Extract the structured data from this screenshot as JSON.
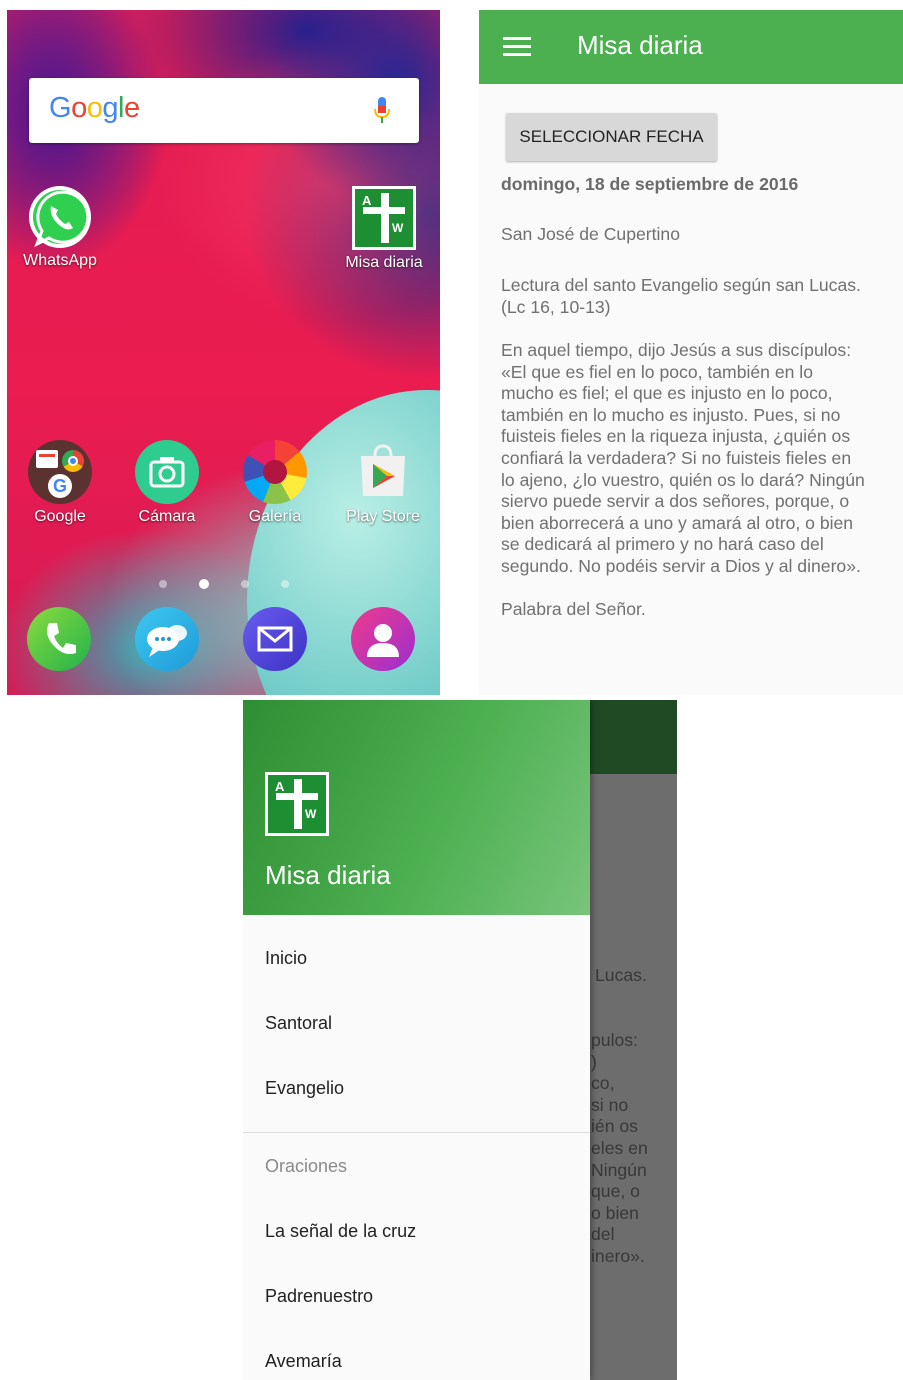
{
  "home": {
    "search": {
      "logo_text": "Google",
      "mic_icon": "mic-icon"
    },
    "apps": [
      {
        "label": "WhatsApp",
        "icon": "whatsapp-icon"
      },
      {
        "label": "Misa diaria",
        "icon": "misa-diaria-icon"
      },
      {
        "label": "Google",
        "icon": "google-folder-icon"
      },
      {
        "label": "Cámara",
        "icon": "camera-icon"
      },
      {
        "label": "Galería",
        "icon": "gallery-icon"
      },
      {
        "label": "Play Store",
        "icon": "play-store-icon"
      }
    ],
    "dock": [
      "phone-icon",
      "messages-icon",
      "email-icon",
      "contacts-icon"
    ],
    "page_dots": {
      "count": 4,
      "active": 1
    }
  },
  "app": {
    "title": "Misa diaria",
    "menu_icon": "hamburger-menu-icon",
    "select_date_label": "SELECCIONAR FECHA",
    "date": "domingo, 18 de septiembre de 2016",
    "saint": "San José de Cupertino",
    "reading_title": [
      "Lectura del santo Evangelio según san Lucas.",
      "(Lc 16, 10-13)"
    ],
    "gospel_lines": [
      "En aquel tiempo, dijo Jesús a sus discípulos:",
      "«El que es fiel en lo poco, también en lo",
      "mucho es fiel; el que es injusto en lo poco,",
      "también en lo mucho es injusto. Pues, si no",
      "fuisteis fieles en la riqueza injusta, ¿quién os",
      "confiará la verdadera? Si no fuisteis fieles en",
      "lo ajeno, ¿lo vuestro, quién os lo dará? Ningún",
      "siervo puede servir a dos señores, porque, o",
      "bien aborrecerá a uno y amará al otro, o bien",
      "se dedicará al primero y no hará caso del",
      "segundo. No podéis servir a Dios y al dinero»."
    ],
    "closing": "Palabra del Señor."
  },
  "drawer": {
    "title": "Misa diaria",
    "logo_icon": "misa-diaria-logo-icon",
    "items": [
      "Inicio",
      "Santoral",
      "Evangelio"
    ],
    "section": "Oraciones",
    "prayers": [
      "La señal de la cruz",
      "Padrenuestro",
      "Avemaría"
    ],
    "behind_fragments": [
      "Lucas.",
      "pulos:\n)\nco,\nsi no\nién os\neles en\nNingún\nque, o\no bien\ndel\ninero»."
    ]
  },
  "colors": {
    "primary": "#4caf50",
    "primary_dark": "#1f4a23",
    "background": "#fafafa",
    "button": "#d8d8d8"
  }
}
